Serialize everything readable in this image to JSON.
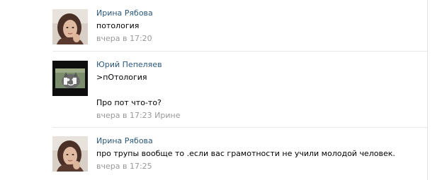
{
  "comments": [
    {
      "author": "Ирина Рябова",
      "avatar_icon": "woman-portrait-avatar",
      "lines": [
        "потология"
      ],
      "time": "вчера в 17:20",
      "reply_to": ""
    },
    {
      "author": "Юрий Пепеляев",
      "avatar_icon": "cat-meme-avatar",
      "lines": [
        ">пОтология",
        "",
        "Про пот что-то?"
      ],
      "time": "вчера в 17:23",
      "reply_to": "Ирине"
    },
    {
      "author": "Ирина Рябова",
      "avatar_icon": "woman-portrait-avatar",
      "lines": [
        "про трупы вообще то .если вас грамотности не учили молодой человек."
      ],
      "time": "вчера в 17:25",
      "reply_to": ""
    }
  ],
  "colors": {
    "author_link": "#2b587a",
    "meta_text": "#999999",
    "divider": "#e7eaed"
  }
}
